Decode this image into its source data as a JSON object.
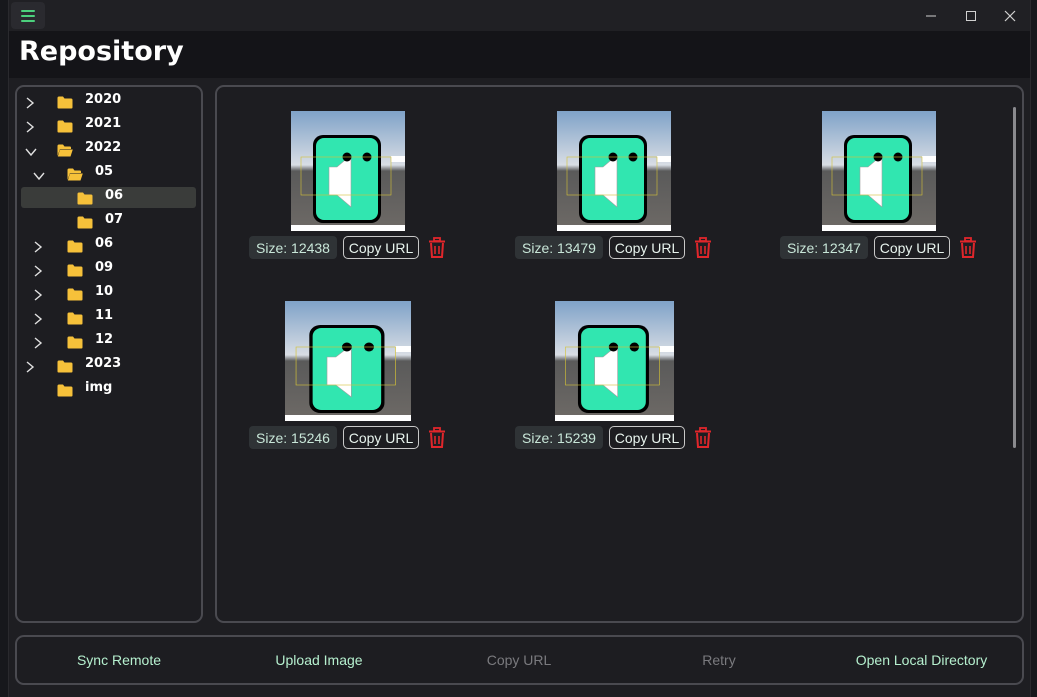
{
  "colors": {
    "accent": "#4cd07d",
    "folder": "#f6c13a",
    "danger": "#e0262b",
    "button_text_enabled": "#b6f0cf",
    "button_text_disabled": "#7a7a7e"
  },
  "titlebar": {
    "menu_icon": "hamburger-icon",
    "minimize_icon": "minimize-icon",
    "maximize_icon": "maximize-icon",
    "close_icon": "close-icon"
  },
  "header": {
    "title": "Repository"
  },
  "tree": {
    "items": [
      {
        "label": "2020",
        "expanded": false,
        "selected": false
      },
      {
        "label": "2021",
        "expanded": false,
        "selected": false
      },
      {
        "label": "2022",
        "expanded": true,
        "selected": false
      },
      {
        "label": "05",
        "expanded": true,
        "selected": false
      },
      {
        "label": "06",
        "expanded": false,
        "selected": true
      },
      {
        "label": "07",
        "expanded": false,
        "selected": false
      },
      {
        "label": "06",
        "expanded": false,
        "selected": false
      },
      {
        "label": "09",
        "expanded": false,
        "selected": false
      },
      {
        "label": "10",
        "expanded": false,
        "selected": false
      },
      {
        "label": "11",
        "expanded": false,
        "selected": false
      },
      {
        "label": "12",
        "expanded": false,
        "selected": false
      },
      {
        "label": "2023",
        "expanded": false,
        "selected": false
      },
      {
        "label": "img",
        "expanded": false,
        "selected": false
      }
    ]
  },
  "images": [
    {
      "size_label": "Size: 12438",
      "copy_label": "Copy URL"
    },
    {
      "size_label": "Size: 13479",
      "copy_label": "Copy URL"
    },
    {
      "size_label": "Size: 12347",
      "copy_label": "Copy URL"
    },
    {
      "size_label": "Size: 15246",
      "copy_label": "Copy URL"
    },
    {
      "size_label": "Size: 15239",
      "copy_label": "Copy URL"
    }
  ],
  "bottom_bar": {
    "sync_remote": "Sync Remote",
    "upload_image": "Upload Image",
    "copy_url": "Copy URL",
    "retry": "Retry",
    "open_local_directory": "Open Local Directory"
  }
}
